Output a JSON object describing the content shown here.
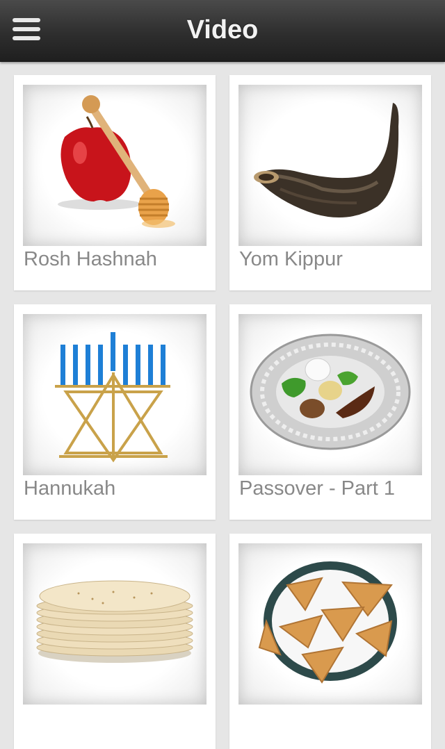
{
  "navbar": {
    "title": "Video",
    "menu_icon": "hamburger-menu-icon"
  },
  "videos": [
    {
      "label": "Rosh Hashnah",
      "image": "apple-honey-dipper"
    },
    {
      "label": "Yom Kippur",
      "image": "shofar"
    },
    {
      "label": "Hannukah",
      "image": "menorah"
    },
    {
      "label": "Passover - Part 1",
      "image": "seder-plate"
    },
    {
      "label": "",
      "image": "matzah-stack"
    },
    {
      "label": "",
      "image": "hamantaschen-plate"
    }
  ]
}
